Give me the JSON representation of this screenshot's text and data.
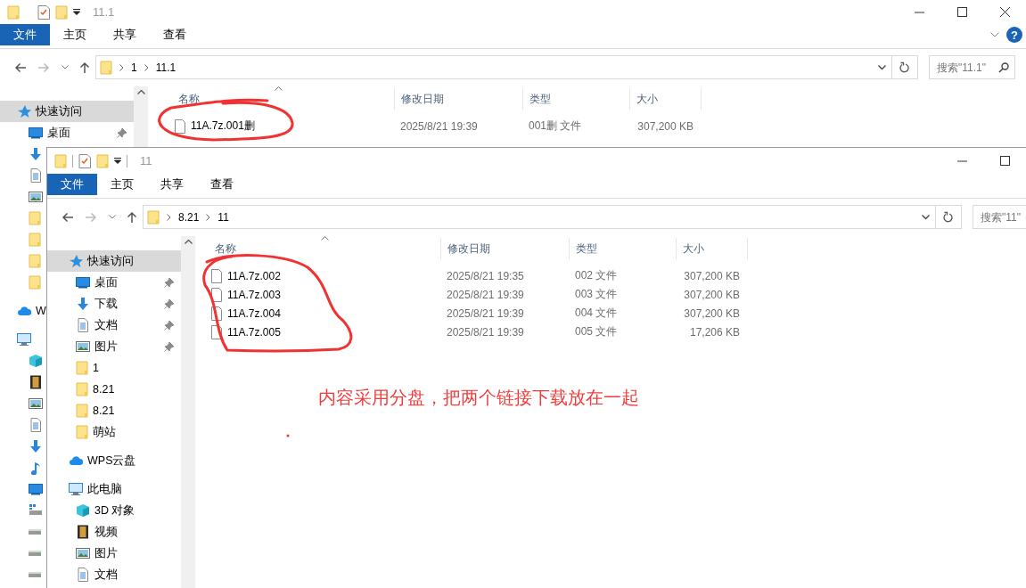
{
  "back_window": {
    "title": "11.1",
    "window_buttons": [
      {
        "kind": "minimize"
      },
      {
        "kind": "maximize"
      },
      {
        "kind": "close"
      }
    ],
    "ribbon_tabs": [
      {
        "label": "文件",
        "selected": true
      },
      {
        "label": "主页",
        "selected": false
      },
      {
        "label": "共享",
        "selected": false
      },
      {
        "label": "查看",
        "selected": false
      }
    ],
    "help": {
      "label": "?"
    },
    "path": [
      "1",
      "11.1"
    ],
    "search": {
      "placeholder": "搜索\"11.1\""
    },
    "sidebar": [
      {
        "label": "快速访问",
        "kind": "star",
        "selected": true,
        "children": [
          {
            "label": "桌面",
            "kind": "desktop",
            "selected": false,
            "pinned": true
          },
          {
            "kind": "download",
            "selected": false
          },
          {
            "kind": "document",
            "selected": false
          },
          {
            "kind": "picture",
            "selected": false
          },
          {
            "kind": "folder",
            "selected": false
          },
          {
            "kind": "folder",
            "selected": false
          },
          {
            "kind": "folder",
            "selected": false
          },
          {
            "kind": "folder",
            "selected": false
          }
        ]
      },
      {
        "label": "W",
        "kind": "cloud",
        "selected": false
      },
      {
        "kind": "pc",
        "selected": false,
        "children": [
          {
            "kind": "cube",
            "selected": false
          },
          {
            "kind": "video",
            "selected": false
          },
          {
            "kind": "picture",
            "selected": false
          },
          {
            "kind": "document",
            "selected": false
          },
          {
            "kind": "download",
            "selected": false
          },
          {
            "kind": "music",
            "selected": false
          },
          {
            "kind": "desktop",
            "selected": false
          },
          {
            "kind": "drive-win",
            "selected": false
          },
          {
            "kind": "drive",
            "selected": false
          },
          {
            "kind": "drive",
            "selected": false
          },
          {
            "kind": "drive",
            "selected": false
          }
        ]
      }
    ],
    "columns": [
      "名称",
      "修改日期",
      "类型",
      "大小"
    ],
    "files": [
      {
        "name": "11A.7z.001删",
        "modified": "2025/8/21 19:39",
        "type": "001删 文件",
        "size": "307,200 KB"
      }
    ]
  },
  "front_window": {
    "title": "11",
    "window_buttons": [
      {
        "kind": "minimize"
      },
      {
        "kind": "maximize"
      }
    ],
    "ribbon_tabs": [
      {
        "label": "文件",
        "selected": true
      },
      {
        "label": "主页",
        "selected": false
      },
      {
        "label": "共享",
        "selected": false
      },
      {
        "label": "查看",
        "selected": false
      }
    ],
    "path": [
      "8.21",
      "11"
    ],
    "search": {
      "placeholder": "搜索\"11\""
    },
    "sidebar": [
      {
        "label": "快速访问",
        "kind": "star",
        "selected": true,
        "children": [
          {
            "label": "桌面",
            "kind": "desktop",
            "selected": false,
            "pinned": true
          },
          {
            "label": "下载",
            "kind": "download",
            "selected": false,
            "pinned": true
          },
          {
            "label": "文档",
            "kind": "document",
            "selected": false,
            "pinned": true
          },
          {
            "label": "图片",
            "kind": "picture",
            "selected": false,
            "pinned": true
          },
          {
            "label": "1",
            "kind": "folder",
            "selected": false,
            "pinned": false
          },
          {
            "label": "8.21",
            "kind": "folder",
            "selected": false,
            "pinned": false
          },
          {
            "label": "8.21",
            "kind": "folder",
            "selected": false,
            "pinned": false
          },
          {
            "label": "萌站",
            "kind": "folder",
            "selected": false,
            "pinned": false
          }
        ]
      },
      {
        "label": "WPS云盘",
        "kind": "cloud",
        "selected": false
      },
      {
        "label": "此电脑",
        "kind": "pc",
        "selected": false,
        "children": [
          {
            "label": "3D 对象",
            "kind": "cube",
            "selected": false
          },
          {
            "label": "视频",
            "kind": "video",
            "selected": false
          },
          {
            "label": "图片",
            "kind": "picture",
            "selected": false
          },
          {
            "label": "文档",
            "kind": "document",
            "selected": false
          }
        ]
      }
    ],
    "columns": [
      "名称",
      "修改日期",
      "类型",
      "大小"
    ],
    "files": [
      {
        "name": "11A.7z.002",
        "modified": "2025/8/21 19:35",
        "type": "002 文件",
        "size": "307,200 KB"
      },
      {
        "name": "11A.7z.003",
        "modified": "2025/8/21 19:39",
        "type": "003 文件",
        "size": "307,200 KB"
      },
      {
        "name": "11A.7z.004",
        "modified": "2025/8/21 19:39",
        "type": "004 文件",
        "size": "307,200 KB"
      },
      {
        "name": "11A.7z.005",
        "modified": "2025/8/21 19:39",
        "type": "005 文件",
        "size": "17,206 KB"
      }
    ]
  },
  "annotation": {
    "text": "内容采用分盘，把两个链接下载放在一起"
  }
}
